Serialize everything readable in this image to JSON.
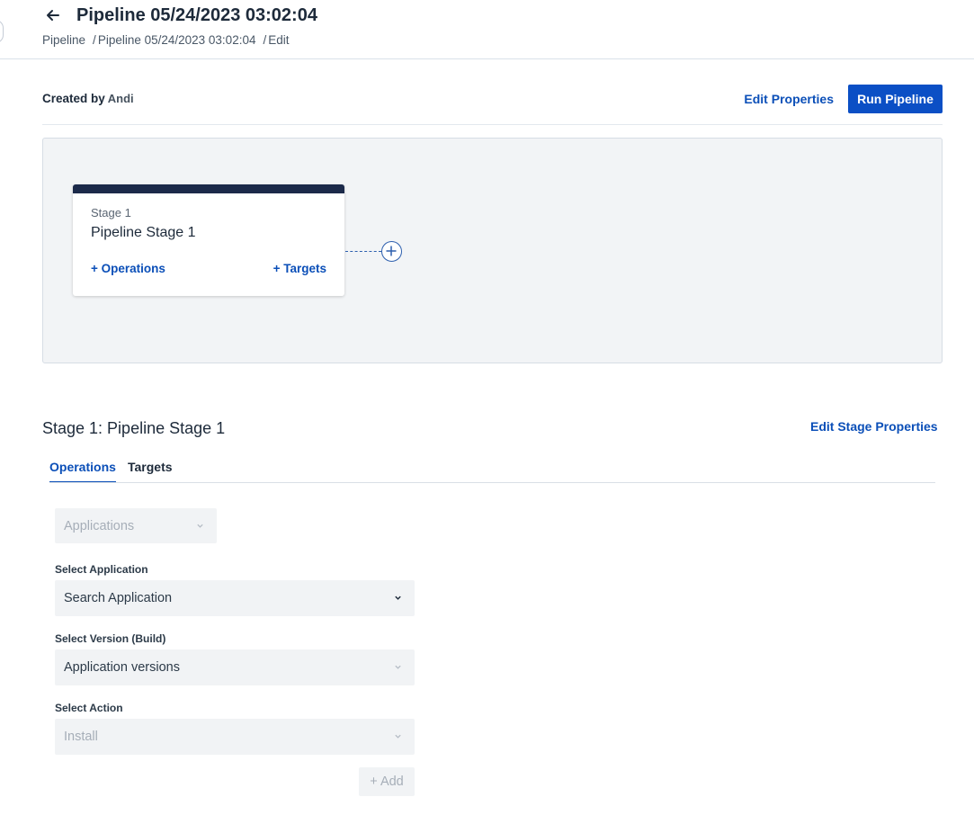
{
  "header": {
    "title": "Pipeline 05/24/2023 03:02:04",
    "breadcrumb": {
      "root": "Pipeline",
      "sep1": "/",
      "item": "Pipeline 05/24/2023 03:02:04",
      "sep2": "/",
      "current": "Edit"
    }
  },
  "meta": {
    "created_by_label": "Created by",
    "author": "Andi"
  },
  "actions": {
    "edit_properties": "Edit Properties",
    "run_pipeline": "Run Pipeline"
  },
  "canvas": {
    "stage": {
      "number": "Stage 1",
      "name": "Pipeline Stage 1",
      "operations_link": "+ Operations",
      "targets_link": "+ Targets"
    }
  },
  "stage_detail": {
    "title": "Stage 1: Pipeline Stage 1",
    "edit_stage_properties": "Edit Stage Properties",
    "tabs": [
      {
        "label": "Operations",
        "active": true
      },
      {
        "label": "Targets",
        "active": false
      }
    ],
    "type_select": {
      "value": "Applications"
    },
    "fields": {
      "application": {
        "label": "Select Application",
        "value": "Search Application"
      },
      "version": {
        "label": "Select Version (Build)",
        "value": "Application versions"
      },
      "action": {
        "label": "Select Action",
        "value": "Install"
      }
    },
    "add_button": "+ Add"
  },
  "colors": {
    "primary": "#0b4fc5",
    "link": "#0b4fb8",
    "stage_bar": "#1c2a4a",
    "canvas_bg": "#f2f4f6",
    "text": "#1d2a3a",
    "disabled_text": "#a6aeb8"
  },
  "icons": {
    "back": "arrow-left-icon",
    "add_stage": "plus-circle-icon",
    "dropdown": "chevron-down-icon"
  }
}
